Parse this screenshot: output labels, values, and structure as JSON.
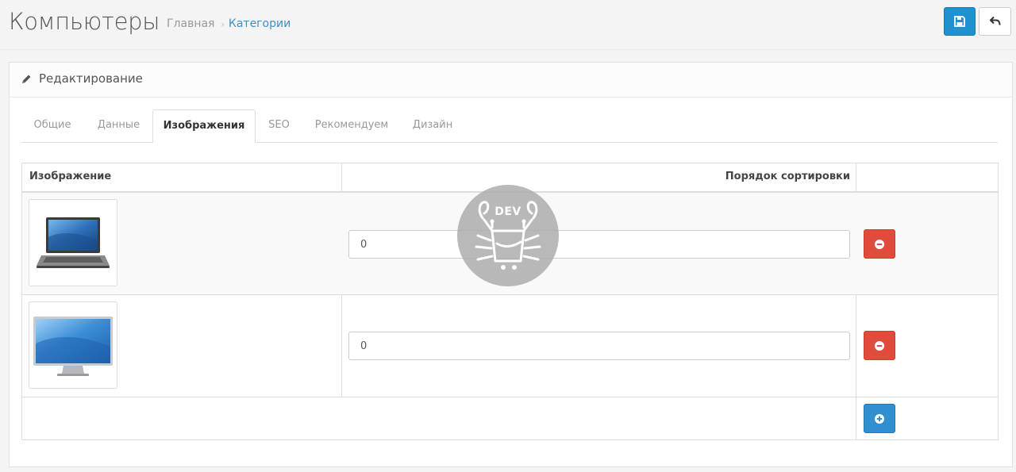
{
  "header": {
    "title": "Компьютеры",
    "breadcrumb": {
      "home": "Главная",
      "separator": "›",
      "current": "Категории"
    },
    "save_icon": "save-icon",
    "back_icon": "back-arrow-icon"
  },
  "panel": {
    "title": "Редактирование",
    "icon": "pencil-icon"
  },
  "tabs": [
    {
      "label": "Общие"
    },
    {
      "label": "Данные"
    },
    {
      "label": "Изображения",
      "active": true
    },
    {
      "label": "SEO"
    },
    {
      "label": "Рекомендуем"
    },
    {
      "label": "Дизайн"
    }
  ],
  "image_table": {
    "headers": {
      "image": "Изображение",
      "sort_order": "Порядок сортировки"
    },
    "rows": [
      {
        "thumbnail": "laptop-image",
        "sort_order": "0"
      },
      {
        "thumbnail": "monitor-image",
        "sort_order": "0"
      }
    ]
  },
  "watermark": {
    "text": "DEV"
  },
  "colors": {
    "primary": "#1e91cf",
    "danger": "#e04b3c",
    "link": "#3d8fc5"
  }
}
